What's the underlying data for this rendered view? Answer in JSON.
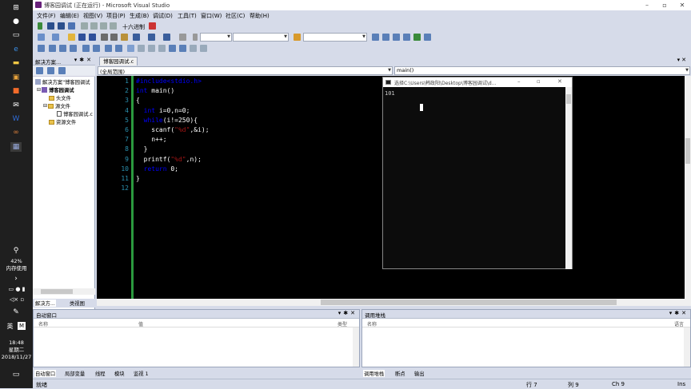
{
  "taskbar": {
    "battery": "42%",
    "memory_label": "内存使用",
    "ime": "英",
    "time": "18:48",
    "weekday": "星期二",
    "date": "2018/11/27"
  },
  "window": {
    "title": "博客园调试 (正在运行) - Microsoft Visual Studio"
  },
  "menu": [
    "文件(F)",
    "编辑(E)",
    "视图(V)",
    "项目(P)",
    "生成(B)",
    "调试(D)",
    "工具(T)",
    "窗口(W)",
    "社区(C)",
    "帮助(H)"
  ],
  "toolbar": {
    "hex_label": "十六进制"
  },
  "solution_explorer": {
    "title": "解决方案...",
    "tree": [
      {
        "label": "解决方案\"博客园调试",
        "level": 0,
        "kind": "solution"
      },
      {
        "label": "博客园调试",
        "level": 1,
        "kind": "project"
      },
      {
        "label": "头文件",
        "level": 2,
        "kind": "folder"
      },
      {
        "label": "源文件",
        "level": 2,
        "kind": "folder"
      },
      {
        "label": "博客园调试.c",
        "level": 3,
        "kind": "file"
      },
      {
        "label": "资源文件",
        "level": 2,
        "kind": "folder"
      }
    ],
    "tabs": [
      "解决方...",
      "类视图"
    ]
  },
  "editor": {
    "tab": "博客园调试.c",
    "scope": "(全局范围)",
    "function": "main()",
    "lines": [
      [
        {
          "t": "#include<stdio.h>",
          "c": "pp"
        }
      ],
      [
        {
          "t": "int",
          "c": "kw"
        },
        {
          "t": " main()",
          "c": ""
        }
      ],
      [
        {
          "t": "{",
          "c": ""
        }
      ],
      [
        {
          "t": "  int",
          "c": "kw"
        },
        {
          "t": " i=0,n=0;",
          "c": ""
        }
      ],
      [
        {
          "t": "  while",
          "c": "kw"
        },
        {
          "t": "(i!=250){",
          "c": ""
        }
      ],
      [
        {
          "t": "    scanf(",
          "c": ""
        },
        {
          "t": "\"%d\"",
          "c": "str"
        },
        {
          "t": ",&i);",
          "c": ""
        }
      ],
      [
        {
          "t": "    n++;",
          "c": ""
        }
      ],
      [
        {
          "t": "  }",
          "c": ""
        }
      ],
      [
        {
          "t": "  printf(",
          "c": ""
        },
        {
          "t": "\"%d\"",
          "c": "str"
        },
        {
          "t": ",n);",
          "c": ""
        }
      ],
      [
        {
          "t": "  return",
          "c": "kw"
        },
        {
          "t": " 0;",
          "c": ""
        }
      ],
      [
        {
          "t": "}",
          "c": ""
        }
      ],
      [
        {
          "t": "",
          "c": ""
        }
      ]
    ]
  },
  "console": {
    "title": "选择C:\\Users\\韩政阳\\Desktop\\博客园调试\\d...",
    "output": "101"
  },
  "autos": {
    "title": "自动窗口",
    "col_name": "名称",
    "col_value": "值",
    "col_type": "类型",
    "tabs": [
      "自动窗口",
      "局部变量",
      "线程",
      "模块",
      "监视 1"
    ]
  },
  "callstack": {
    "title": "调用堆栈",
    "col_name": "名称",
    "col_lang": "语言",
    "tabs": [
      "调用堆栈",
      "断点",
      "输出"
    ]
  },
  "status": {
    "ready": "就绪",
    "row": "行 7",
    "col": "列 9",
    "ch": "Ch 9",
    "ins": "Ins"
  }
}
